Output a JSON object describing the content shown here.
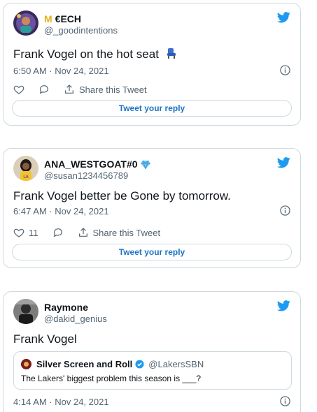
{
  "colors": {
    "twitter_blue": "#1d9bf0",
    "link_blue": "#1d74c3",
    "muted": "#536471",
    "border": "#cfd9de"
  },
  "tweets": [
    {
      "display_name_prefix": "M",
      "display_name": "€ECH",
      "handle": "@_goodintentions",
      "text": "Frank Vogel on the hot seat",
      "emoji": "seat-emoji",
      "time": "6:50 AM · Nov 24, 2021",
      "like_count": "",
      "share_label": "Share this Tweet",
      "reply_label": "Tweet your reply"
    },
    {
      "display_name": "ANA_WESTGOAT#0",
      "badge": "diamond-emoji",
      "handle": "@susan1234456789",
      "text": "Frank Vogel better be Gone by tomorrow.",
      "time": "6:47 AM · Nov 24, 2021",
      "like_count": "11",
      "share_label": "Share this Tweet",
      "reply_label": "Tweet your reply"
    },
    {
      "display_name": "Raymone",
      "handle": "@dakid_genius",
      "text": "Frank Vogel",
      "time": "4:14 AM · Nov 24, 2021",
      "quote": {
        "display_name": "Silver Screen and Roll",
        "handle": "@LakersSBN",
        "text": "The Lakers' biggest problem this season is ___?"
      }
    }
  ]
}
